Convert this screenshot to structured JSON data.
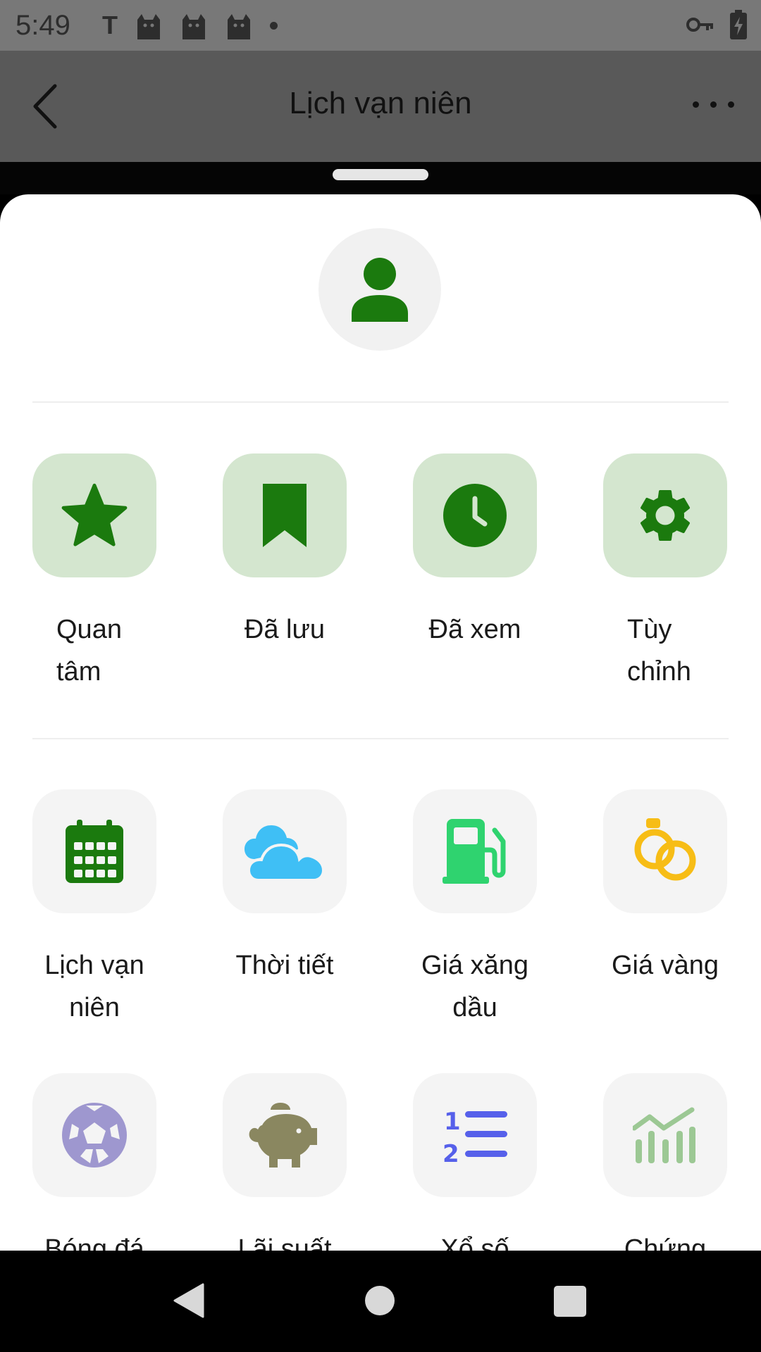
{
  "status_bar": {
    "time": "5:49",
    "notification_letter": "T",
    "icons": [
      "t-icon",
      "cat-icon",
      "cat-icon",
      "cat-icon",
      "dot-icon",
      "vpn-key-icon",
      "battery-charging-icon"
    ]
  },
  "app_bar": {
    "title": "Lịch vạn niên",
    "icons": [
      "back-chevron-icon",
      "more-horizontal-icon"
    ]
  },
  "sheet": {
    "avatar_icon": "user-icon",
    "personal_items": [
      {
        "label_lines": [
          "Quan",
          "tâm"
        ],
        "icon": "star-icon"
      },
      {
        "label_lines": [
          "Đã lưu"
        ],
        "icon": "bookmark-icon"
      },
      {
        "label_lines": [
          "Đã xem"
        ],
        "icon": "clock-icon"
      },
      {
        "label_lines": [
          "Tùy",
          "chỉnh"
        ],
        "icon": "gear-icon"
      }
    ],
    "utility_items": [
      {
        "label_lines": [
          "Lịch vạn",
          "niên"
        ],
        "icon": "calendar-icon"
      },
      {
        "label_lines": [
          "Thời tiết"
        ],
        "icon": "cloud-icon"
      },
      {
        "label_lines": [
          "Giá xăng",
          "dầu"
        ],
        "icon": "fuel-pump-icon"
      },
      {
        "label_lines": [
          "Giá vàng"
        ],
        "icon": "rings-icon"
      },
      {
        "label_lines": [
          "Bóng đá"
        ],
        "icon": "soccer-ball-icon"
      },
      {
        "label_lines": [
          "Lãi suất"
        ],
        "icon": "piggy-bank-icon"
      },
      {
        "label_lines": [
          "Xổ số"
        ],
        "icon": "numbered-list-icon"
      },
      {
        "label_lines": [
          "Chứng"
        ],
        "icon": "stock-chart-icon"
      }
    ]
  },
  "nav_bar": {
    "icons": [
      "nav-back-icon",
      "nav-home-icon",
      "nav-recents-icon"
    ]
  },
  "colors": {
    "accent_green": "#1b7a0e",
    "tile_green_bg": "#d4e6cf",
    "tile_gray_bg": "#f4f4f4",
    "weather_blue": "#3fbff5",
    "fuel_green": "#2fd36f",
    "gold": "#f7bd16",
    "soccer_purple": "#9e97cf",
    "piggy_olive": "#8a8760",
    "lottery_blue": "#5660ea",
    "stock_green": "#9cc894"
  }
}
